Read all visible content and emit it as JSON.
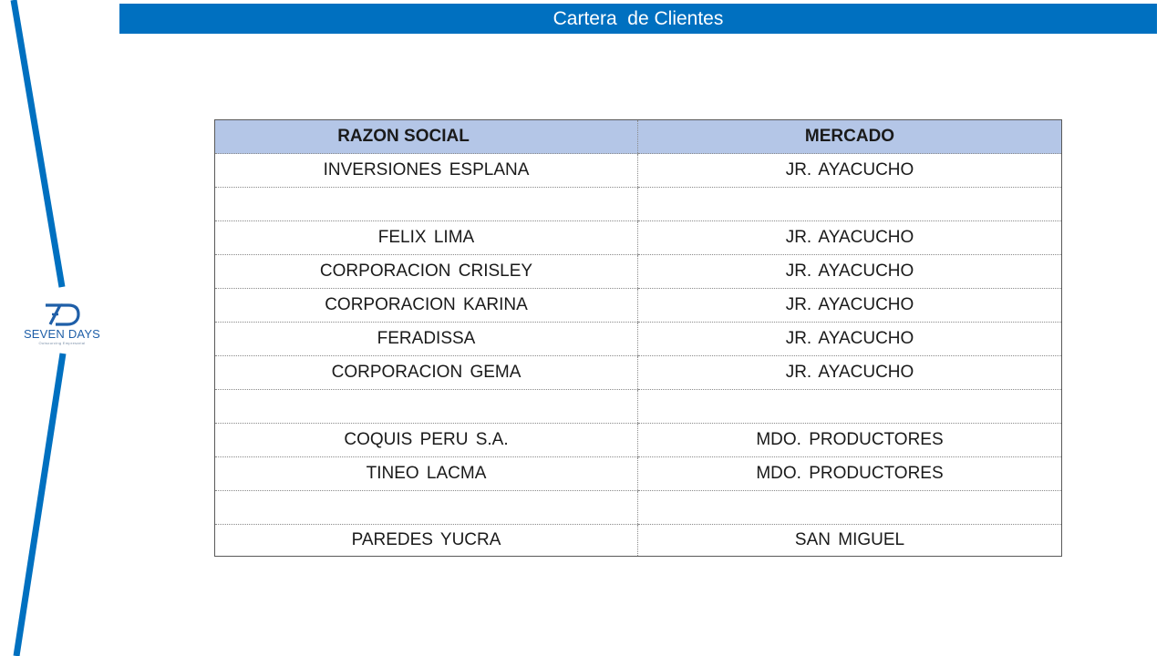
{
  "header": {
    "title": "Cartera  de Clientes"
  },
  "logo": {
    "mark": "7D",
    "name": "SEVEN DAYS",
    "tagline": "Outsourcing Empresarial"
  },
  "table": {
    "columns": [
      "RAZON SOCIAL",
      "MERCADO"
    ],
    "rows": [
      [
        "INVERSIONES ESPLANA",
        "JR. AYACUCHO"
      ],
      [
        "",
        ""
      ],
      [
        "FELIX LIMA",
        "JR. AYACUCHO"
      ],
      [
        "CORPORACION CRISLEY",
        "JR. AYACUCHO"
      ],
      [
        "CORPORACION KARINA",
        "JR. AYACUCHO"
      ],
      [
        "FERADISSA",
        "JR. AYACUCHO"
      ],
      [
        "CORPORACION GEMA",
        "JR. AYACUCHO"
      ],
      [
        "",
        ""
      ],
      [
        "COQUIS PERU S.A.",
        "MDO. PRODUCTORES"
      ],
      [
        "TINEO LACMA",
        "MDO. PRODUCTORES"
      ],
      [
        "",
        ""
      ],
      [
        "PAREDES YUCRA",
        "SAN MIGUEL"
      ]
    ]
  },
  "colors": {
    "title_bar": "#0070c0",
    "header_fill": "#b4c6e7",
    "accent_line": "#0070c0",
    "logo": "#1f5fa8"
  }
}
